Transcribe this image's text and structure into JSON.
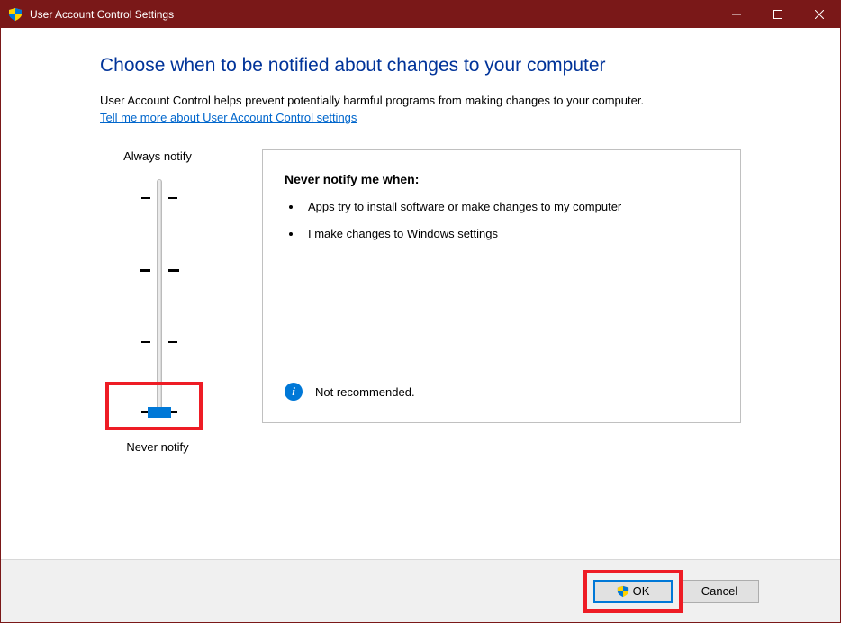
{
  "titlebar": {
    "title": "User Account Control Settings"
  },
  "heading": "Choose when to be notified about changes to your computer",
  "description": "User Account Control helps prevent potentially harmful programs from making changes to your computer.",
  "link_text": "Tell me more about User Account Control settings",
  "slider": {
    "top_label": "Always notify",
    "bottom_label": "Never notify",
    "position": 3,
    "ticks": 4
  },
  "panel": {
    "title": "Never notify me when:",
    "bullets": [
      "Apps try to install software or make changes to my computer",
      "I make changes to Windows settings"
    ],
    "recommendation": "Not recommended."
  },
  "buttons": {
    "ok": "OK",
    "cancel": "Cancel"
  },
  "highlight_targets": [
    "slider-thumb-area",
    "ok-button"
  ]
}
